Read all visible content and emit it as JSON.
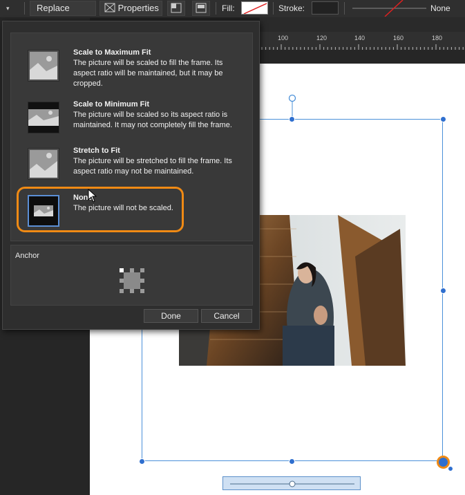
{
  "toolbar": {
    "replace_image_label": "Replace image",
    "properties_label": "Properties",
    "fill_label": "Fill:",
    "stroke_label": "Stroke:",
    "stroke_style_value": "None"
  },
  "ruler": {
    "ticks": [
      "100",
      "120",
      "140",
      "160",
      "180"
    ]
  },
  "popup": {
    "options": [
      {
        "title": "Scale to Maximum Fit",
        "description": "The picture will be scaled to fill the frame. Its aspect ratio will be maintained, but it may be cropped."
      },
      {
        "title": "Scale to Minimum Fit",
        "description": "The picture will be scaled so its aspect ratio is maintained. It may not completely fill the frame."
      },
      {
        "title": "Stretch to Fit",
        "description": "The picture will be stretched to fill the frame. Its aspect ratio may not be maintained."
      },
      {
        "title": "None",
        "description": "The picture will not be scaled."
      }
    ],
    "selected_option": "None",
    "anchor_label": "Anchor",
    "done_label": "Done",
    "cancel_label": "Cancel"
  },
  "colors": {
    "accent": "#f08a14",
    "selection": "#4a90d9",
    "panel": "#393939"
  }
}
